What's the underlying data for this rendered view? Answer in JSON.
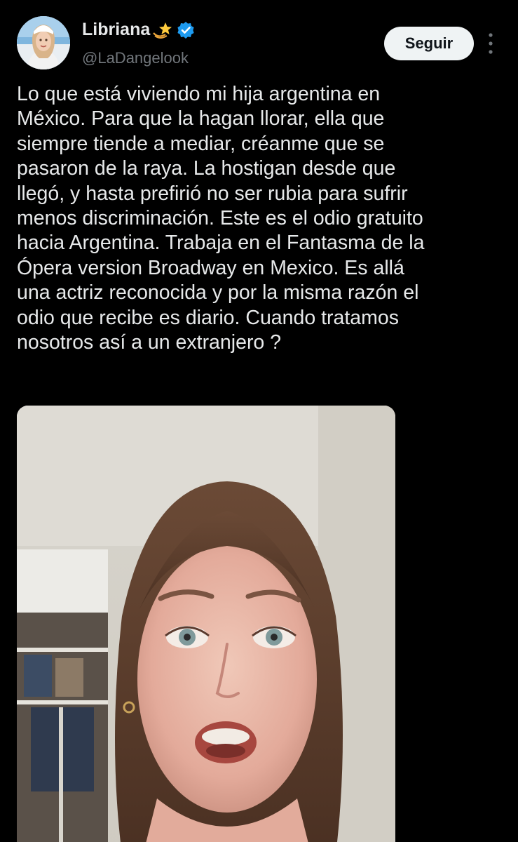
{
  "author": {
    "display_name": "Libriana",
    "name_emoji": "dizzy-star-icon",
    "verified": true,
    "verified_badge": "verified-badge-icon",
    "handle": "@LaDangelook",
    "avatar": "profile-photo"
  },
  "actions": {
    "follow_label": "Seguir",
    "more_icon": "vertical-dots-icon"
  },
  "tweet": {
    "text": "Lo que está viviendo mi hija argentina en\nMéxico. Para que la hagan llorar, ella que\nsiempre tiende a mediar, créanme que se\npasaron de la raya. La hostigan desde que\nllegó, y hasta prefirió no ser rubia para sufrir\nmenos discriminación. Este es el odio gratuito\nhacia Argentina. Trabaja en el Fantasma de la\nÓpera version Broadway en Mexico. Es allá\nuna actriz reconocida y por la misma razón el\nodio que recibe es diario. Cuando tratamos\nnosotros así a un extranjero ?"
  },
  "media": {
    "kind": "video-still",
    "subject": "woman-crying-face"
  },
  "colors": {
    "background": "#000000",
    "text_primary": "#e7e9ea",
    "text_secondary": "#71767b",
    "follow_button_bg": "#eff3f4",
    "follow_button_text": "#0f1419",
    "verified_blue": "#1d9bf0"
  }
}
